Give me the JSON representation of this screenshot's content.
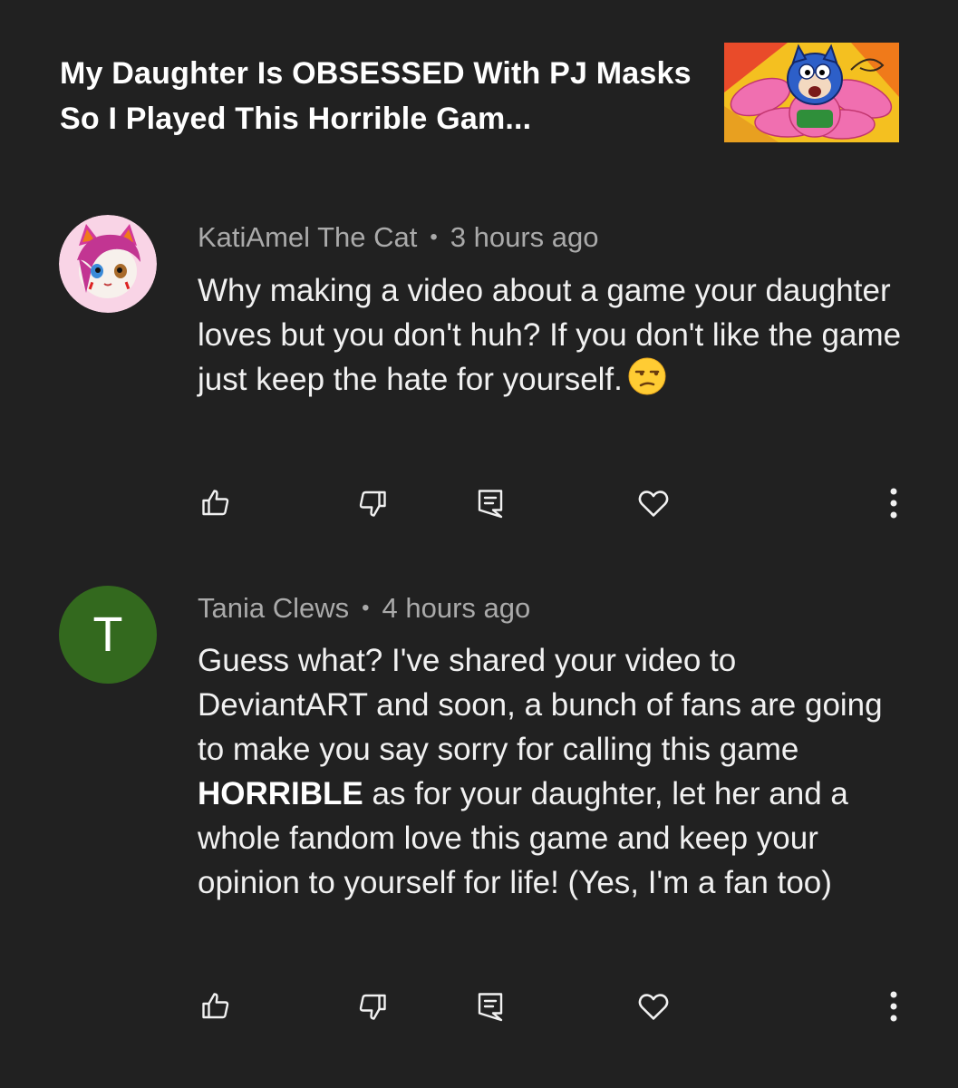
{
  "video": {
    "title": "My Daughter Is OBSESSED With PJ Masks So I Played This Horrible Gam..."
  },
  "comments": [
    {
      "author": "KatiAmel The Cat",
      "time": "3 hours ago",
      "text": "Why making a video about a game your daughter loves but you don't huh? If you don't like the game just keep the hate for yourself.",
      "emoji": "unamused-face-emoji"
    },
    {
      "author": "Tania Clews",
      "avatar_letter": "T",
      "time": "4 hours ago",
      "text_before": "Guess what? I've shared your video to DeviantART and soon, a bunch of fans are going to make you say sorry for calling this game ",
      "text_bold": "HORRIBLE",
      "text_after": " as for your daughter, let her and a whole fandom love this game and keep your opinion to yourself for life! (Yes, I'm a fan too)"
    }
  ],
  "icons": [
    "thumbs-up-icon",
    "thumbs-down-icon",
    "reply-icon",
    "heart-icon",
    "more-vert-icon"
  ],
  "colors": {
    "background": "#212121",
    "text": "#f1f1f1",
    "meta": "#aaaaaa",
    "avatar_green": "#33691e"
  }
}
